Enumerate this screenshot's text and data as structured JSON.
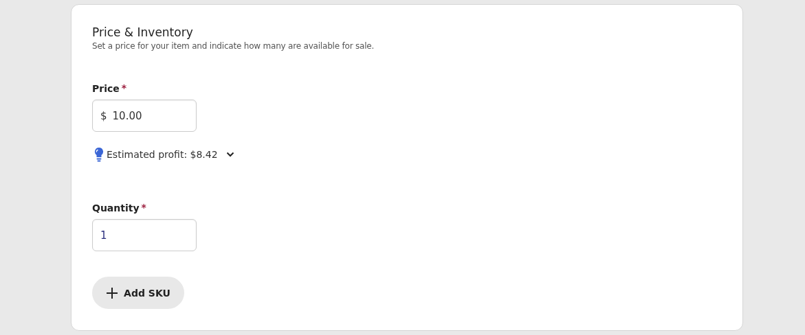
{
  "section": {
    "title": "Price & Inventory",
    "subtitle": "Set a price for your item and indicate how many are available for sale."
  },
  "fields": [
    {
      "kind": "currency",
      "label": "Price",
      "required_mark": "*",
      "prefix": "$",
      "value": "10.00"
    },
    {
      "kind": "profit",
      "text": "Estimated profit: $8.42",
      "expanded": false
    },
    {
      "kind": "number",
      "label": "Quantity",
      "required_mark": "*",
      "value": "1"
    }
  ],
  "add_button": {
    "label": "Add SKU"
  }
}
